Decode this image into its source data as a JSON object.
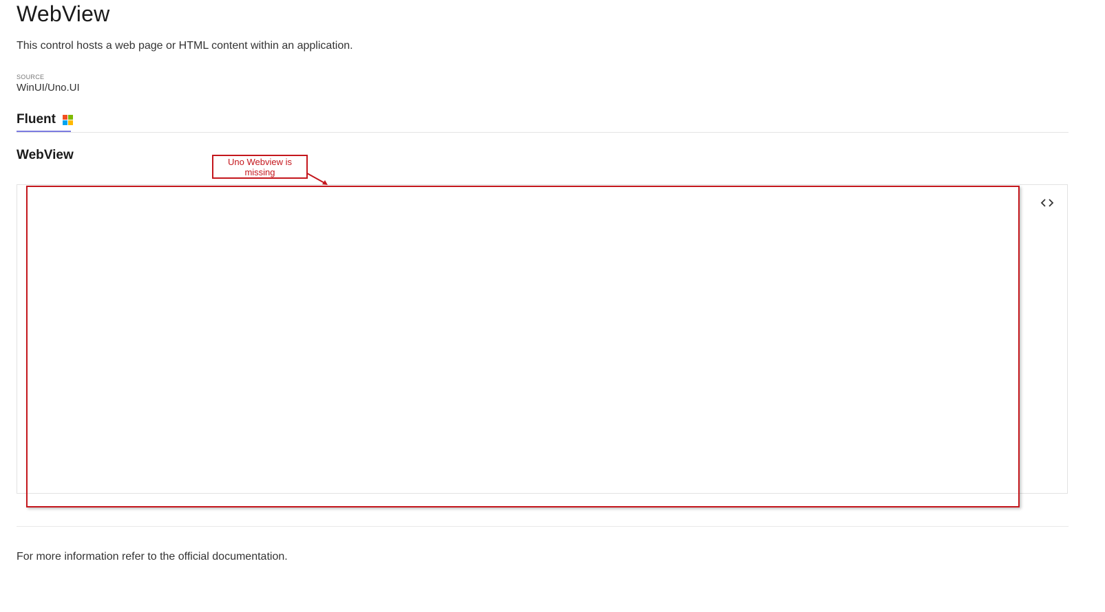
{
  "page": {
    "title": "WebView",
    "description": "This control hosts a web page or HTML content within an application."
  },
  "source": {
    "label": "SOURCE",
    "value": "WinUI/Uno.UI"
  },
  "tabs": [
    {
      "label": "Fluent",
      "icon": "microsoft-logo-icon",
      "selected": true
    }
  ],
  "section": {
    "title": "WebView"
  },
  "sample": {
    "code_toggle_icon": "code-icon"
  },
  "annotation": {
    "text": "Uno Webview is missing",
    "color": "#c4161c"
  },
  "footer": {
    "prefix": "For more information refer to the ",
    "link_text": "official documentation."
  },
  "colors": {
    "tab_indicator": "#7a7ae0",
    "ms_red": "#f25022",
    "ms_green": "#7fba00",
    "ms_blue": "#00a4ef",
    "ms_yellow": "#ffb900"
  }
}
